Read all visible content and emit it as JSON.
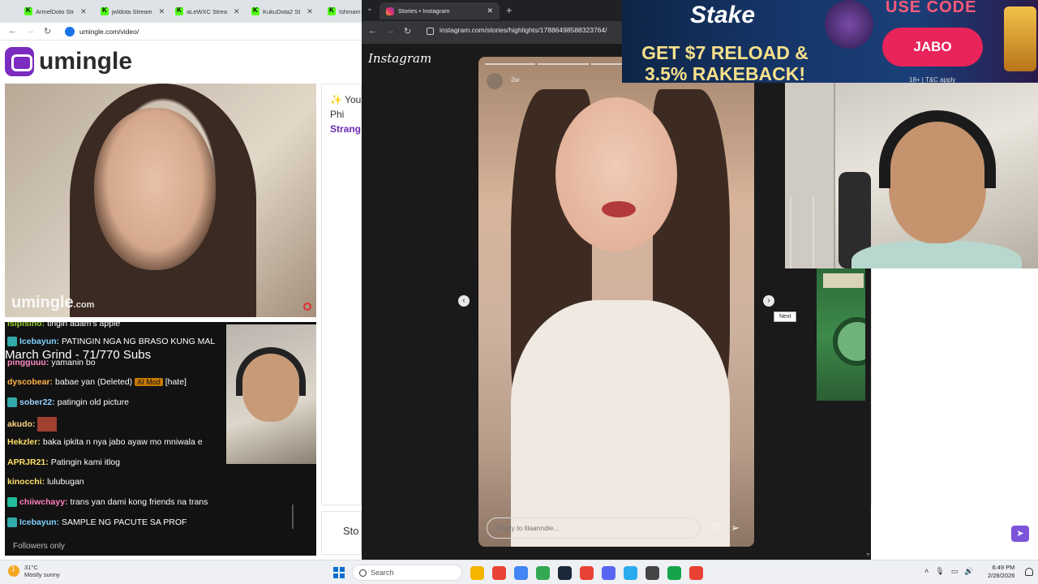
{
  "left_browser": {
    "tabs": [
      {
        "label": "ArmelDoto Str"
      },
      {
        "label": "jwldota Stream"
      },
      {
        "label": "aLeWXC Strea"
      },
      {
        "label": "KukuDota2 St"
      },
      {
        "label": "Ishmam"
      }
    ],
    "url": "umingle.com/video/"
  },
  "umingle": {
    "brand": "umingle",
    "watermark": "umingle",
    "watermark_suffix": ".com",
    "panel_line1": "✨ You",
    "panel_line2": "Phi",
    "panel_line3": "Strang",
    "stop_label": "Sto"
  },
  "chat": {
    "goal": "March Grind - 71/770 Subs",
    "messages": [
      {
        "user": "isipisino:",
        "text": "tingin adam's apple",
        "color": "#9acd32"
      },
      {
        "user": "Icebayun:",
        "text": "PATINGIN NGA NG BRASO KUNG MAL",
        "color": "#7fd1ff"
      },
      {
        "user": "pingguuu:",
        "text": "yamanin bo",
        "color": "#ff8ac4"
      },
      {
        "user": "dyscobear:",
        "text": "babae yan (Deleted)",
        "color": "#ffb347",
        "mod": "AI Mod",
        "tag": "[hate]"
      },
      {
        "user": "sober22:",
        "text": "patingin old picture",
        "color": "#9ad0ff"
      },
      {
        "user": "akudo:",
        "text": "",
        "color": "#ffd27f"
      },
      {
        "user": "Hekzler:",
        "text": "baka ipkita n nya jabo ayaw mo mniwala e",
        "color": "#ffe066"
      },
      {
        "user": "APRJR21:",
        "text": "Patingin kami itlog",
        "color": "#ffe066"
      },
      {
        "user": "kinocchi:",
        "text": "lulubugan",
        "color": "#ffe066"
      },
      {
        "user": "chiiwchayy:",
        "text": "trans yan dami kong friends na trans",
        "color": "#ff7fbf"
      },
      {
        "user": "Icebayun:",
        "text": "SAMPLE NG PACUTE SA PROF",
        "color": "#7fd1ff"
      }
    ],
    "followers_only": "Followers only"
  },
  "instagram": {
    "tab_title": "Stories • Instagram",
    "url": "instagram.com/stories/highlights/17886498588323764/",
    "logo": "Instagram",
    "story_time": "2w",
    "reply_placeholder": "Reply to lilaanndie...",
    "next_tooltip": "Next"
  },
  "ad": {
    "brand": "Stake",
    "promo": "GET $7 RELOAD & 3.5% RAKEBACK!",
    "use_code": "USE CODE",
    "code": "JABO",
    "terms": "18+ | T&C apply"
  },
  "taskbar": {
    "temp": "31°C",
    "weather": "Mostly sunny",
    "search_label": "Search",
    "time": "6:49 PM",
    "date": "2/28/2026",
    "app_colors": [
      "#f4b400",
      "#e94235",
      "#4285f4",
      "#34a853",
      "#1b2838",
      "#e94235",
      "#5865f2",
      "#2aabee",
      "#444444",
      "#16a34a",
      "#e94235"
    ]
  }
}
